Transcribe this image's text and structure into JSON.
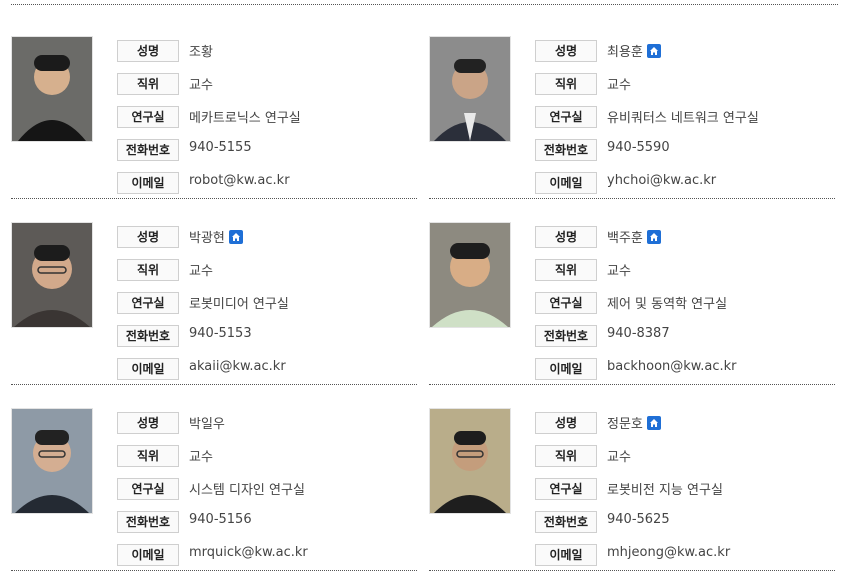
{
  "labels": {
    "name": "성명",
    "position": "직위",
    "lab": "연구실",
    "phone": "전화번호",
    "email": "이메일"
  },
  "faculty": [
    {
      "name": "조황",
      "position": "교수",
      "lab": "메카트로닉스 연구실",
      "phone": "940-5155",
      "email": "robot@kw.ac.kr",
      "homepage_icon": false
    },
    {
      "name": "최용훈",
      "position": "교수",
      "lab": "유비쿼터스 네트워크 연구실",
      "phone": "940-5590",
      "email": "yhchoi@kw.ac.kr",
      "homepage_icon": true
    },
    {
      "name": "박광현",
      "position": "교수",
      "lab": "로봇미디어 연구실",
      "phone": "940-5153",
      "email": "akaii@kw.ac.kr",
      "homepage_icon": true
    },
    {
      "name": "백주훈",
      "position": "교수",
      "lab": "제어 및 동역학 연구실",
      "phone": "940-8387",
      "email": "backhoon@kw.ac.kr",
      "homepage_icon": true
    },
    {
      "name": "박일우",
      "position": "교수",
      "lab": "시스템 디자인 연구실",
      "phone": "940-5156",
      "email": "mrquick@kw.ac.kr",
      "homepage_icon": false
    },
    {
      "name": "정문호",
      "position": "교수",
      "lab": "로봇비전 지능 연구실",
      "phone": "940-5625",
      "email": "mhjeong@kw.ac.kr",
      "homepage_icon": true
    }
  ],
  "colors": {
    "label_border": "#cfcfcf",
    "home_icon": "#1f6fd6",
    "divider": "#555555"
  }
}
